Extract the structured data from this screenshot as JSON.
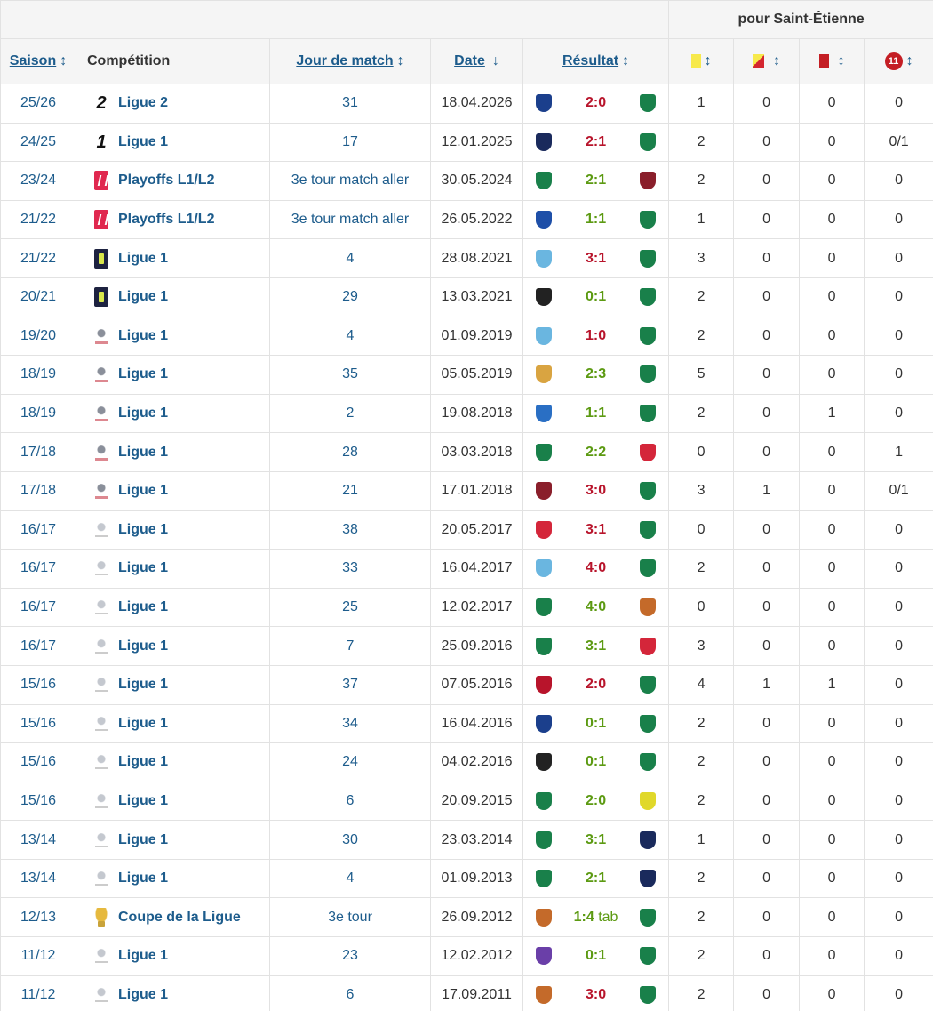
{
  "header": {
    "group_title": "pour Saint-Étienne",
    "saison": "Saison",
    "competition": "Compétition",
    "jour": "Jour de match",
    "date": "Date",
    "resultat": "Résultat",
    "sort_arrow": "↕",
    "sort_desc": "↓",
    "penalty_label": "11"
  },
  "colors": {
    "link": "#1d5c8c",
    "win": "#5c9a12",
    "loss": "#b8142b"
  },
  "rows": [
    {
      "saison": "25/26",
      "logo": "l2",
      "competition": "Ligue 2",
      "jour": "31",
      "date": "18.04.2026",
      "home": "#1b3f8c",
      "away": "#19804a",
      "score": "2:0",
      "tab": "",
      "res": "loss",
      "yellow": "1",
      "yr": "0",
      "red": "0",
      "pen": "0"
    },
    {
      "saison": "24/25",
      "logo": "l2",
      "competition": "Ligue 1",
      "jour": "17",
      "date": "12.01.2025",
      "home": "#1a2a5c",
      "away": "#19804a",
      "score": "2:1",
      "tab": "",
      "res": "loss",
      "yellow": "2",
      "yr": "0",
      "red": "0",
      "pen": "0/1"
    },
    {
      "saison": "23/24",
      "logo": "lfp",
      "competition": "Playoffs L1/L2",
      "jour": "3e tour match aller",
      "date": "30.05.2024",
      "home": "#19804a",
      "away": "#8a1f2b",
      "score": "2:1",
      "tab": "",
      "res": "win",
      "yellow": "2",
      "yr": "0",
      "red": "0",
      "pen": "0"
    },
    {
      "saison": "21/22",
      "logo": "lfp",
      "competition": "Playoffs L1/L2",
      "jour": "3e tour match aller",
      "date": "26.05.2022",
      "home": "#1e4fa8",
      "away": "#19804a",
      "score": "1:1",
      "tab": "",
      "res": "draw",
      "yellow": "1",
      "yr": "0",
      "red": "0",
      "pen": "0"
    },
    {
      "saison": "21/22",
      "logo": "navy",
      "competition": "Ligue 1",
      "jour": "4",
      "date": "28.08.2021",
      "home": "#6ab6e0",
      "away": "#19804a",
      "score": "3:1",
      "tab": "",
      "res": "loss",
      "yellow": "3",
      "yr": "0",
      "red": "0",
      "pen": "0"
    },
    {
      "saison": "20/21",
      "logo": "navy",
      "competition": "Ligue 1",
      "jour": "29",
      "date": "13.03.2021",
      "home": "#222222",
      "away": "#19804a",
      "score": "0:1",
      "tab": "",
      "res": "win",
      "yellow": "2",
      "yr": "0",
      "red": "0",
      "pen": "0"
    },
    {
      "saison": "19/20",
      "logo": "old",
      "competition": "Ligue 1",
      "jour": "4",
      "date": "01.09.2019",
      "home": "#6ab6e0",
      "away": "#19804a",
      "score": "1:0",
      "tab": "",
      "res": "loss",
      "yellow": "2",
      "yr": "0",
      "red": "0",
      "pen": "0"
    },
    {
      "saison": "18/19",
      "logo": "old",
      "competition": "Ligue 1",
      "jour": "35",
      "date": "05.05.2019",
      "home": "#d9a441",
      "away": "#19804a",
      "score": "2:3",
      "tab": "",
      "res": "win",
      "yellow": "5",
      "yr": "0",
      "red": "0",
      "pen": "0"
    },
    {
      "saison": "18/19",
      "logo": "old",
      "competition": "Ligue 1",
      "jour": "2",
      "date": "19.08.2018",
      "home": "#2a6fc4",
      "away": "#19804a",
      "score": "1:1",
      "tab": "",
      "res": "draw",
      "yellow": "2",
      "yr": "0",
      "red": "1",
      "pen": "0"
    },
    {
      "saison": "17/18",
      "logo": "old",
      "competition": "Ligue 1",
      "jour": "28",
      "date": "03.03.2018",
      "home": "#19804a",
      "away": "#d4263a",
      "score": "2:2",
      "tab": "",
      "res": "draw",
      "yellow": "0",
      "yr": "0",
      "red": "0",
      "pen": "1"
    },
    {
      "saison": "17/18",
      "logo": "old",
      "competition": "Ligue 1",
      "jour": "21",
      "date": "17.01.2018",
      "home": "#8a1f2b",
      "away": "#19804a",
      "score": "3:0",
      "tab": "",
      "res": "loss",
      "yellow": "3",
      "yr": "1",
      "red": "0",
      "pen": "0/1"
    },
    {
      "saison": "16/17",
      "logo": "oldgrey",
      "competition": "Ligue 1",
      "jour": "38",
      "date": "20.05.2017",
      "home": "#d4263a",
      "away": "#19804a",
      "score": "3:1",
      "tab": "",
      "res": "loss",
      "yellow": "0",
      "yr": "0",
      "red": "0",
      "pen": "0"
    },
    {
      "saison": "16/17",
      "logo": "oldgrey",
      "competition": "Ligue 1",
      "jour": "33",
      "date": "16.04.2017",
      "home": "#6ab6e0",
      "away": "#19804a",
      "score": "4:0",
      "tab": "",
      "res": "loss",
      "yellow": "2",
      "yr": "0",
      "red": "0",
      "pen": "0"
    },
    {
      "saison": "16/17",
      "logo": "oldgrey",
      "competition": "Ligue 1",
      "jour": "25",
      "date": "12.02.2017",
      "home": "#19804a",
      "away": "#c46a2a",
      "score": "4:0",
      "tab": "",
      "res": "win",
      "yellow": "0",
      "yr": "0",
      "red": "0",
      "pen": "0"
    },
    {
      "saison": "16/17",
      "logo": "oldgrey",
      "competition": "Ligue 1",
      "jour": "7",
      "date": "25.09.2016",
      "home": "#19804a",
      "away": "#d4263a",
      "score": "3:1",
      "tab": "",
      "res": "win",
      "yellow": "3",
      "yr": "0",
      "red": "0",
      "pen": "0"
    },
    {
      "saison": "15/16",
      "logo": "oldgrey",
      "competition": "Ligue 1",
      "jour": "37",
      "date": "07.05.2016",
      "home": "#b8142b",
      "away": "#19804a",
      "score": "2:0",
      "tab": "",
      "res": "loss",
      "yellow": "4",
      "yr": "1",
      "red": "1",
      "pen": "0"
    },
    {
      "saison": "15/16",
      "logo": "oldgrey",
      "competition": "Ligue 1",
      "jour": "34",
      "date": "16.04.2016",
      "home": "#1b3f8c",
      "away": "#19804a",
      "score": "0:1",
      "tab": "",
      "res": "win",
      "yellow": "2",
      "yr": "0",
      "red": "0",
      "pen": "0"
    },
    {
      "saison": "15/16",
      "logo": "oldgrey",
      "competition": "Ligue 1",
      "jour": "24",
      "date": "04.02.2016",
      "home": "#222222",
      "away": "#19804a",
      "score": "0:1",
      "tab": "",
      "res": "win",
      "yellow": "2",
      "yr": "0",
      "red": "0",
      "pen": "0"
    },
    {
      "saison": "15/16",
      "logo": "oldgrey",
      "competition": "Ligue 1",
      "jour": "6",
      "date": "20.09.2015",
      "home": "#19804a",
      "away": "#e0d82a",
      "score": "2:0",
      "tab": "",
      "res": "win",
      "yellow": "2",
      "yr": "0",
      "red": "0",
      "pen": "0"
    },
    {
      "saison": "13/14",
      "logo": "oldgrey",
      "competition": "Ligue 1",
      "jour": "30",
      "date": "23.03.2014",
      "home": "#19804a",
      "away": "#1a2a5c",
      "score": "3:1",
      "tab": "",
      "res": "win",
      "yellow": "1",
      "yr": "0",
      "red": "0",
      "pen": "0"
    },
    {
      "saison": "13/14",
      "logo": "oldgrey",
      "competition": "Ligue 1",
      "jour": "4",
      "date": "01.09.2013",
      "home": "#19804a",
      "away": "#1a2a5c",
      "score": "2:1",
      "tab": "",
      "res": "win",
      "yellow": "2",
      "yr": "0",
      "red": "0",
      "pen": "0"
    },
    {
      "saison": "12/13",
      "logo": "cup",
      "competition": "Coupe de la Ligue",
      "jour": "3e tour",
      "date": "26.09.2012",
      "home": "#c46a2a",
      "away": "#19804a",
      "score": "1:4",
      "tab": "tab",
      "res": "win",
      "yellow": "2",
      "yr": "0",
      "red": "0",
      "pen": "0"
    },
    {
      "saison": "11/12",
      "logo": "oldgrey",
      "competition": "Ligue 1",
      "jour": "23",
      "date": "12.02.2012",
      "home": "#6a3fa8",
      "away": "#19804a",
      "score": "0:1",
      "tab": "",
      "res": "win",
      "yellow": "2",
      "yr": "0",
      "red": "0",
      "pen": "0"
    },
    {
      "saison": "11/12",
      "logo": "oldgrey",
      "competition": "Ligue 1",
      "jour": "6",
      "date": "17.09.2011",
      "home": "#c46a2a",
      "away": "#19804a",
      "score": "3:0",
      "tab": "",
      "res": "loss",
      "yellow": "2",
      "yr": "0",
      "red": "0",
      "pen": "0"
    }
  ]
}
